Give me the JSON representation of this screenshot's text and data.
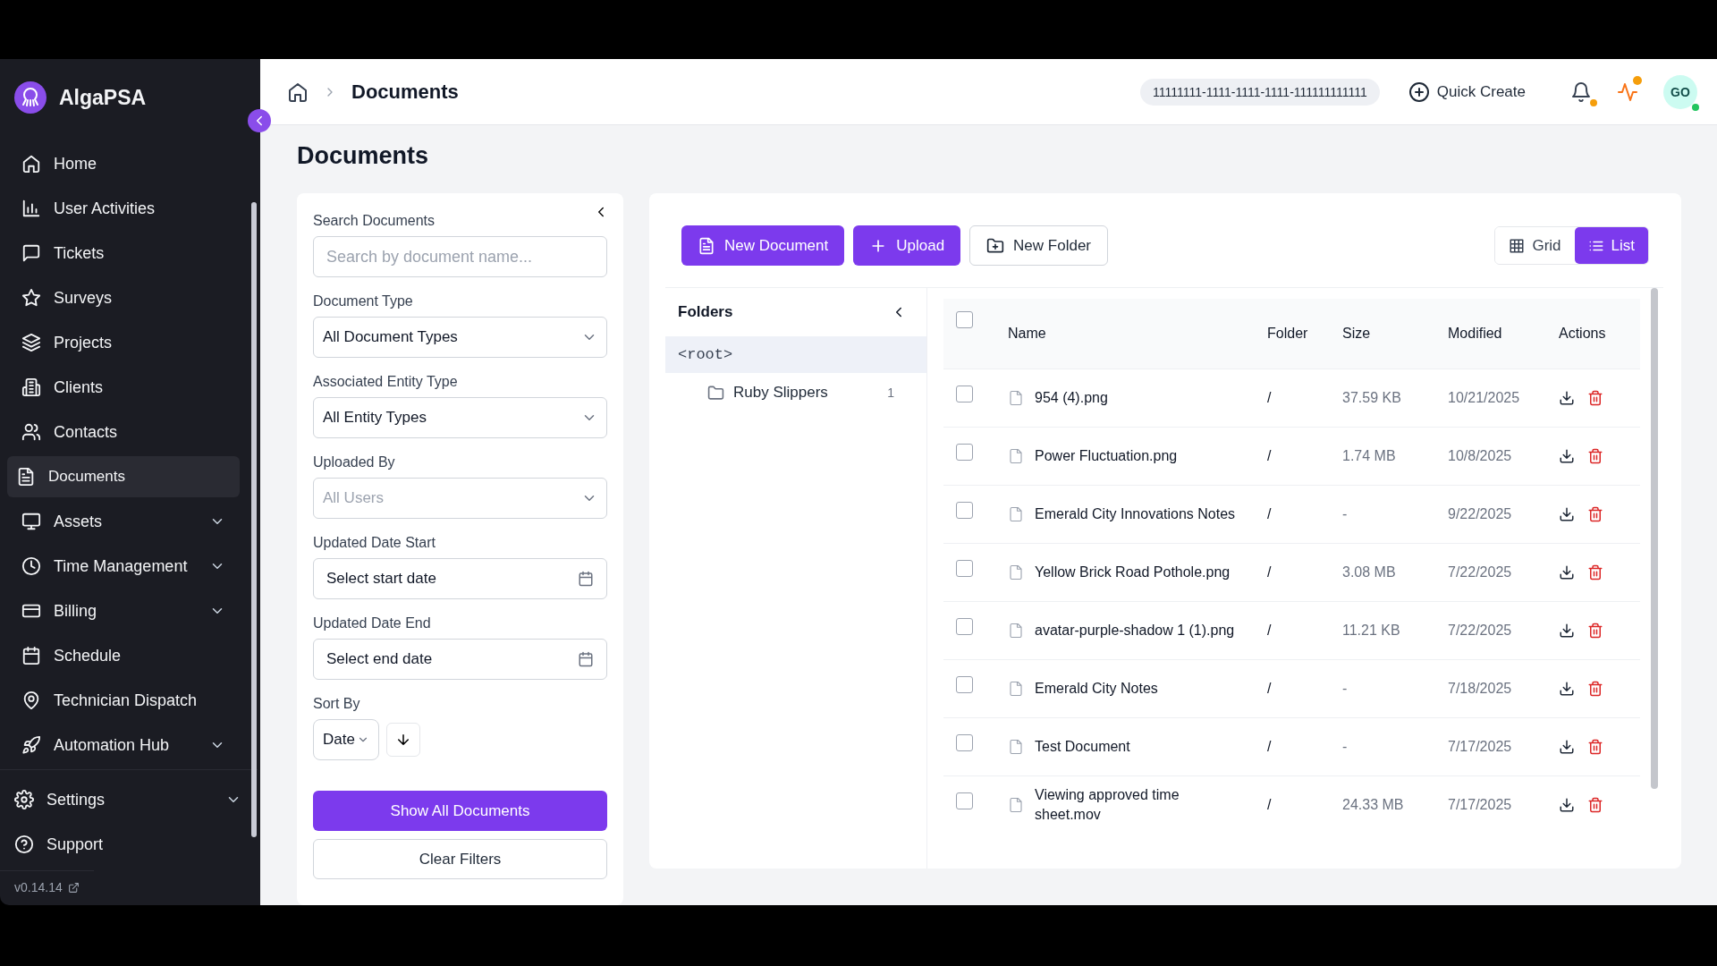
{
  "app": {
    "name": "AlgaPSA",
    "version": "v0.14.14"
  },
  "sidebar": {
    "items": [
      {
        "label": "Home",
        "selected": false,
        "expandable": false
      },
      {
        "label": "User Activities",
        "selected": false,
        "expandable": false
      },
      {
        "label": "Tickets",
        "selected": false,
        "expandable": false
      },
      {
        "label": "Surveys",
        "selected": false,
        "expandable": false
      },
      {
        "label": "Projects",
        "selected": false,
        "expandable": false
      },
      {
        "label": "Clients",
        "selected": false,
        "expandable": false
      },
      {
        "label": "Contacts",
        "selected": false,
        "expandable": false
      },
      {
        "label": "Documents",
        "selected": true,
        "expandable": false
      },
      {
        "label": "Assets",
        "selected": false,
        "expandable": true
      },
      {
        "label": "Time Management",
        "selected": false,
        "expandable": true
      },
      {
        "label": "Billing",
        "selected": false,
        "expandable": true
      },
      {
        "label": "Schedule",
        "selected": false,
        "expandable": false
      },
      {
        "label": "Technician Dispatch",
        "selected": false,
        "expandable": false
      },
      {
        "label": "Automation Hub",
        "selected": false,
        "expandable": true
      }
    ],
    "footer_items": [
      {
        "label": "Settings",
        "expandable": true
      },
      {
        "label": "Support",
        "expandable": false
      }
    ]
  },
  "header": {
    "breadcrumb": "Documents",
    "tenant_id": "11111111-1111-1111-1111-111111111111",
    "quick_create": "Quick Create",
    "avatar_initials": "GO"
  },
  "page": {
    "title": "Documents"
  },
  "filters": {
    "search_label": "Search Documents",
    "search_placeholder": "Search by document name...",
    "selects": [
      {
        "label": "Document Type",
        "value": "All Document Types",
        "placeholder_style": false
      },
      {
        "label": "Associated Entity Type",
        "value": "All Entity Types",
        "placeholder_style": false
      },
      {
        "label": "Uploaded By",
        "value": "All Users",
        "placeholder_style": true
      }
    ],
    "dates": [
      {
        "label": "Updated Date Start",
        "placeholder": "Select start date"
      },
      {
        "label": "Updated Date End",
        "placeholder": "Select end date"
      }
    ],
    "sort_label": "Sort By",
    "sort_value": "Date",
    "show_all": "Show All Documents",
    "clear": "Clear Filters"
  },
  "toolbar": {
    "new_document": "New Document",
    "upload": "Upload",
    "new_folder": "New Folder",
    "views": [
      {
        "label": "Grid",
        "selected": false
      },
      {
        "label": "List",
        "selected": true
      }
    ]
  },
  "folders": {
    "title": "Folders",
    "root": {
      "label": "<root>",
      "selected": true
    },
    "children": [
      {
        "name": "Ruby Slippers",
        "count": "1",
        "selected": false
      }
    ]
  },
  "table": {
    "all_checked": false,
    "columns": [
      "Name",
      "Folder",
      "Size",
      "Modified",
      "Actions"
    ],
    "rows": [
      {
        "checked": false,
        "name": "954 (4).png",
        "folder": "/",
        "size": "37.59 KB",
        "modified": "10/21/2025"
      },
      {
        "checked": false,
        "name": "Power Fluctuation.png",
        "folder": "/",
        "size": "1.74 MB",
        "modified": "10/8/2025"
      },
      {
        "checked": false,
        "name": "Emerald City Innovations Notes",
        "folder": "/",
        "size": "-",
        "modified": "9/22/2025"
      },
      {
        "checked": false,
        "name": "Yellow Brick Road Pothole.png",
        "folder": "/",
        "size": "3.08 MB",
        "modified": "7/22/2025"
      },
      {
        "checked": false,
        "name": "avatar-purple-shadow 1 (1).png",
        "folder": "/",
        "size": "11.21 KB",
        "modified": "7/22/2025"
      },
      {
        "checked": false,
        "name": "Emerald City Notes",
        "folder": "/",
        "size": "-",
        "modified": "7/18/2025"
      },
      {
        "checked": false,
        "name": "Test Document",
        "folder": "/",
        "size": "-",
        "modified": "7/17/2025"
      },
      {
        "checked": false,
        "name": "Viewing approved time sheet.mov",
        "folder": "/",
        "size": "24.33 MB",
        "modified": "7/17/2025"
      }
    ]
  }
}
